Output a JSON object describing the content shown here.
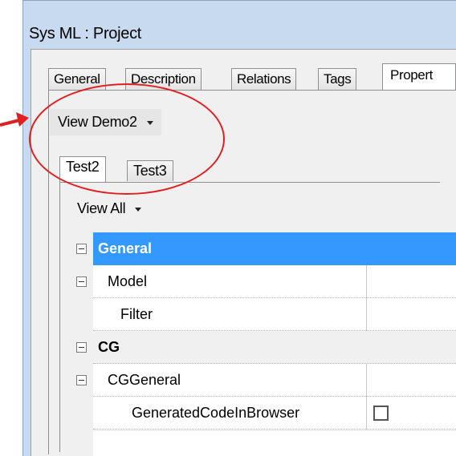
{
  "window": {
    "title": "Sys ML : Project"
  },
  "tabs": [
    {
      "label": "General",
      "active": false
    },
    {
      "label": "Description",
      "active": false
    },
    {
      "label": "Relations",
      "active": false
    },
    {
      "label": "Tags",
      "active": false
    },
    {
      "label": "Propert",
      "active": true
    }
  ],
  "view_dropdown": {
    "label": "View Demo2"
  },
  "sub_tabs": [
    {
      "label": "Test2",
      "active": true
    },
    {
      "label": "Test3",
      "active": false
    }
  ],
  "filter_dropdown": {
    "label": "View All"
  },
  "property_grid": {
    "rows": [
      {
        "label": "General",
        "kind": "category",
        "selected": true
      },
      {
        "label": "Model",
        "kind": "group",
        "value": ""
      },
      {
        "label": "Filter",
        "kind": "item",
        "value": ""
      },
      {
        "label": "CG",
        "kind": "category",
        "selected": false
      },
      {
        "label": "CGGeneral",
        "kind": "group",
        "value": ""
      },
      {
        "label": "GeneratedCodeInBrowser",
        "kind": "checkbox",
        "checked": false
      }
    ]
  },
  "colors": {
    "selection": "#3399ff",
    "annotation": "#e02020",
    "window_frame": "#c8daf0"
  }
}
